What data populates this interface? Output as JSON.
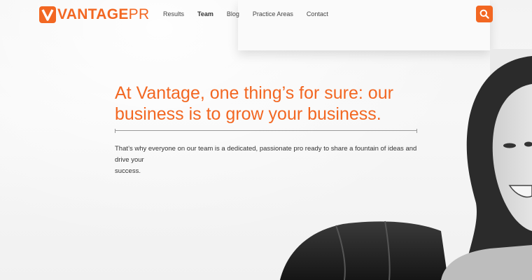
{
  "brand": {
    "name_bold": "VANTAGE",
    "name_light": "PR",
    "color": "#f26722"
  },
  "nav": {
    "items": [
      {
        "label": "Results",
        "active": false
      },
      {
        "label": "Team",
        "active": true
      },
      {
        "label": "Blog",
        "active": false
      },
      {
        "label": "Practice Areas",
        "active": false
      },
      {
        "label": "Contact",
        "active": false
      }
    ]
  },
  "search": {
    "icon": "search-icon"
  },
  "hero": {
    "headline_line1": "At Vantage, one thing’s for sure: our",
    "headline_line2": "business is to grow your business.",
    "body_line1": "That’s why everyone on our team is a dedicated, passionate pro ready to share a fountain of ideas and drive your",
    "body_line2": "success."
  }
}
